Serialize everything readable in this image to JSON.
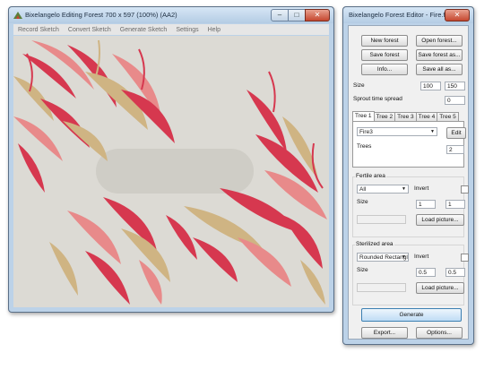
{
  "editor": {
    "title": "Bixelangelo Editing Forest 700 x 597 (100%) (AA2)",
    "window_buttons": [
      "–",
      "□",
      "✕"
    ],
    "menu": [
      "Record Sketch",
      "Convert Sketch",
      "Generate Sketch",
      "Settings",
      "Help"
    ]
  },
  "dialog": {
    "title": "Bixelangelo Forest Editor - Fire.forest",
    "close_label": "✕",
    "buttons": {
      "new_forest": "New forest",
      "open_forest": "Open forest...",
      "save_forest": "Save forest",
      "save_forest_as": "Save forest as...",
      "info": "Info...",
      "save_all_as": "Save all as..."
    },
    "size": {
      "label": "Size",
      "width": "100",
      "height": "150"
    },
    "sprout": {
      "label": "Sprout time spread",
      "value": "0"
    },
    "tabs": [
      "Tree 1",
      "Tree 2",
      "Tree 3",
      "Tree 4",
      "Tree 5"
    ],
    "tree": {
      "selected": "Fire3",
      "edit_label": "Edit",
      "trees_label": "Trees",
      "trees_value": "2"
    },
    "fertile": {
      "title": "Fertile area",
      "shape": "All",
      "invert_label": "Invert",
      "size_label": "Size",
      "w": "1",
      "h": "1",
      "load_label": "Load picture..."
    },
    "sterilized": {
      "title": "Sterilized area",
      "shape": "Rounded Rectangle",
      "invert_label": "Invert",
      "size_label": "Size",
      "w": "0.5",
      "h": "0.5",
      "load_label": "Load picture..."
    },
    "generate_label": "Generate",
    "export_label": "Export...",
    "options_label": "Options..."
  },
  "colors": {
    "red": "#d6384f",
    "pink": "#e88a8a",
    "tan": "#cfb483",
    "canvas": "#dcdad4",
    "window_frame": "#bcd2e8"
  }
}
